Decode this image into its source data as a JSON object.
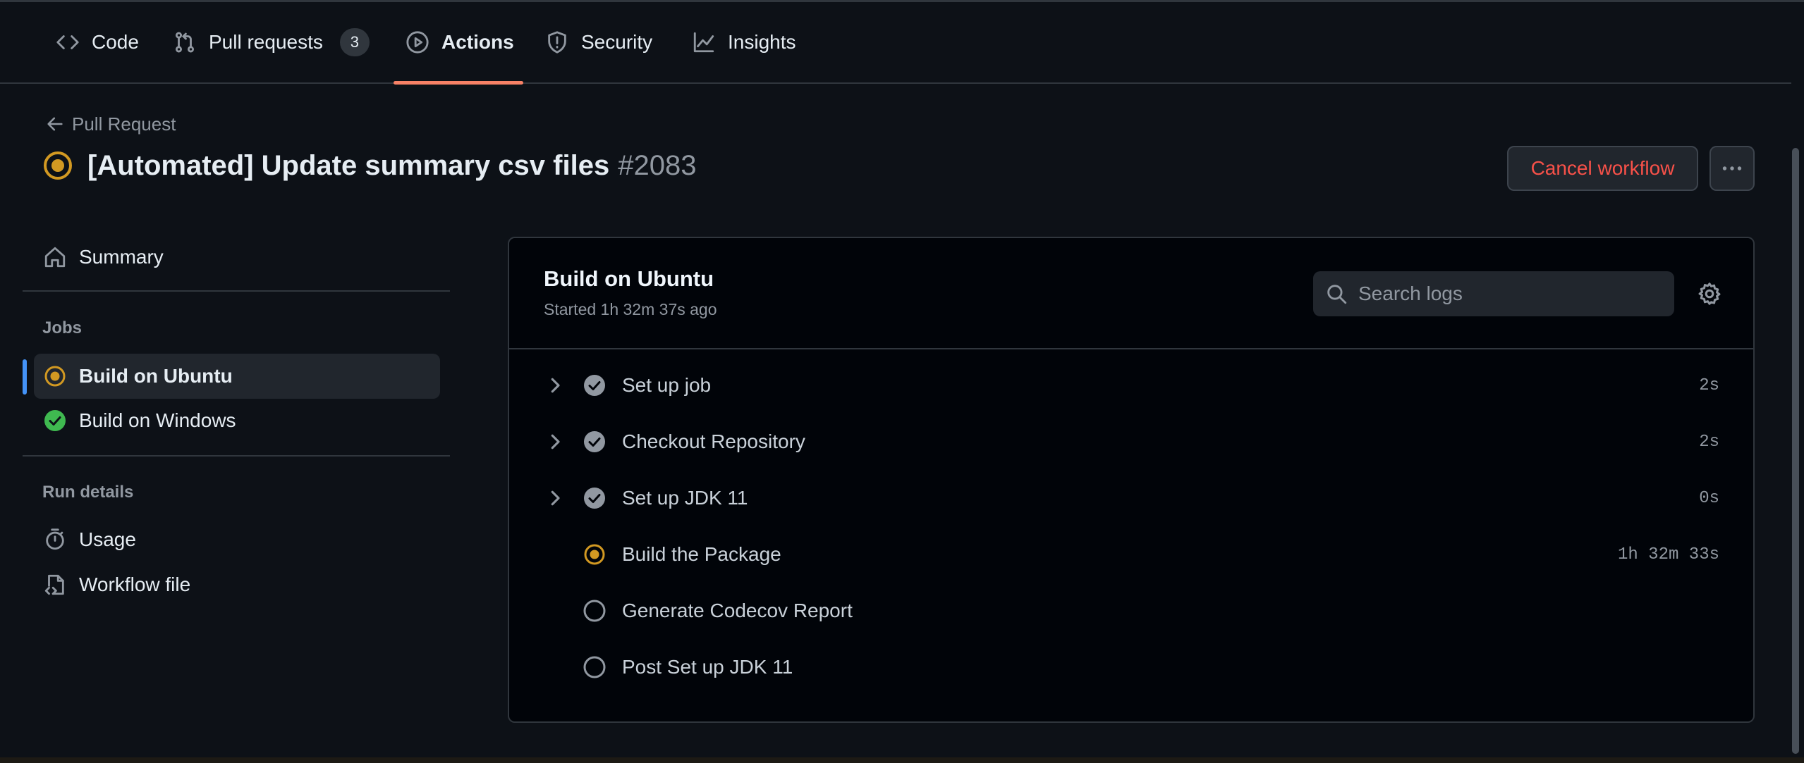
{
  "nav": {
    "tabs": [
      {
        "label": "Code",
        "icon": "code-icon"
      },
      {
        "label": "Pull requests",
        "icon": "git-pull-request-icon",
        "count": "3"
      },
      {
        "label": "Actions",
        "icon": "play-icon",
        "active": true
      },
      {
        "label": "Security",
        "icon": "shield-icon"
      },
      {
        "label": "Insights",
        "icon": "graph-icon"
      }
    ]
  },
  "header": {
    "back_label": "Pull Request",
    "title": "[Automated] Update summary csv files",
    "run_number": "#2083",
    "cancel_label": "Cancel workflow",
    "status": "in-progress"
  },
  "sidebar": {
    "summary_label": "Summary",
    "jobs_heading": "Jobs",
    "jobs": [
      {
        "label": "Build on Ubuntu",
        "status": "in-progress",
        "selected": true
      },
      {
        "label": "Build on Windows",
        "status": "success"
      }
    ],
    "run_details_heading": "Run details",
    "details": [
      {
        "label": "Usage",
        "icon": "stopwatch-icon"
      },
      {
        "label": "Workflow file",
        "icon": "file-code-icon"
      }
    ]
  },
  "job": {
    "title": "Build on Ubuntu",
    "started": "Started 1h 32m 37s ago",
    "search_placeholder": "Search logs",
    "steps": [
      {
        "label": "Set up job",
        "status": "success",
        "time": "2s",
        "expandable": true
      },
      {
        "label": "Checkout Repository",
        "status": "success",
        "time": "2s",
        "expandable": true
      },
      {
        "label": "Set up JDK 11",
        "status": "success",
        "time": "0s",
        "expandable": true
      },
      {
        "label": "Build the Package",
        "status": "in-progress",
        "time": "1h 32m 33s",
        "expandable": false
      },
      {
        "label": "Generate Codecov Report",
        "status": "queued",
        "time": "",
        "expandable": false
      },
      {
        "label": "Post Set up JDK 11",
        "status": "queued",
        "time": "",
        "expandable": false
      }
    ]
  },
  "colors": {
    "accent_underline": "#f78166",
    "in_progress": "#d29922",
    "success": "#3fb950",
    "danger": "#f85149",
    "selection_bar": "#4493f8"
  }
}
